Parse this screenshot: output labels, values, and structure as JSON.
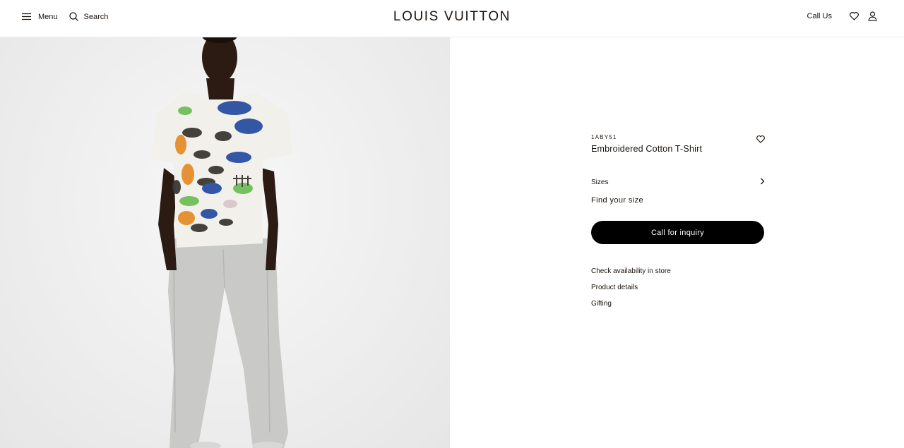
{
  "header": {
    "menu_label": "Menu",
    "search_label": "Search",
    "logo": "LOUIS VUITTON",
    "call_us": "Call Us"
  },
  "product": {
    "sku": "1ABY51",
    "title": "Embroidered Cotton T-Shirt",
    "sizes_label": "Sizes",
    "find_size": "Find your size",
    "cta": "Call for inquiry",
    "links": [
      "Check availability in store",
      "Product details",
      "Gifting"
    ]
  },
  "colors": {
    "text": "#19110b",
    "cta_background": "#000000",
    "cta_text": "#ffffff",
    "media_background": "#eeeeee"
  },
  "icons": [
    "hamburger-icon",
    "search-icon",
    "heart-icon",
    "account-icon",
    "chevron-right-icon"
  ]
}
